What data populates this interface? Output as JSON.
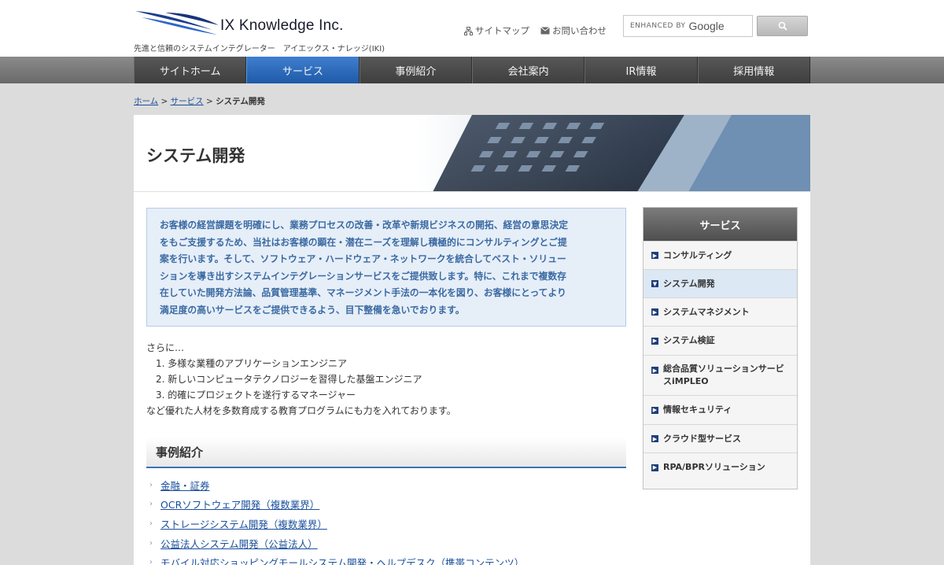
{
  "header": {
    "company_name": "IX Knowledge Inc.",
    "tagline": "先進と信頼のシステムインテグレーター　アイエックス・ナレッジ(IKI)",
    "sitemap_label": "サイトマップ",
    "contact_label": "お問い合わせ",
    "search_enhanced": "ENHANCED BY",
    "search_google": "Google",
    "search_button_icon": "search-icon"
  },
  "nav": {
    "items": [
      "サイトホーム",
      "サービス",
      "事例紹介",
      "会社案内",
      "IR情報",
      "採用情報"
    ],
    "active_index": 1
  },
  "breadcrumb": {
    "home": "ホーム",
    "sep1": " > ",
    "service": "サービス",
    "sep2": " > ",
    "current": "システム開発"
  },
  "page": {
    "title": "システム開発",
    "intro_lines": [
      "お客様の経営課題を明確にし、業務プロセスの改善・改革や新規ビジネスの開拓、経営の意思決定",
      "をもご支援するため、当社はお客様の顕在・潜在ニーズを理解し積極的にコンサルティングとご提",
      "案を行います。そして、ソフトウェア・ハードウェア・ネットワークを統合してベスト・ソリュー",
      "ションを導き出すシステムインテグレーションサービスをご提供致します。特に、これまで複数存",
      "在していた開発方法論、品質管理基準、マネージメント手法の一本化を図り、お客様にとってより",
      "満足度の高いサービスをご提供できるよう、目下整備を急いでおります。"
    ],
    "more_intro": "さらに…",
    "more_items": [
      "1. 多様な業種のアプリケーションエンジニア",
      "2. 新しいコンピュータテクノロジーを習得した基盤エンジニア",
      "3. 的確にプロジェクトを遂行するマネージャー"
    ],
    "more_outro": "など優れた人材を多数育成する教育プログラムにも力を入れております。",
    "cases_heading": "事例紹介",
    "cases": [
      "金融・証券",
      "OCRソフトウェア開発（複数業界）",
      "ストレージシステム開発（複数業界）",
      "公益法人システム開発（公益法人）",
      "モバイル対応ショッピングモールシステム開発・ヘルプデスク（携帯コンテンツ）"
    ]
  },
  "side_menu": {
    "title": "サービス",
    "items": [
      "コンサルティング",
      "システム開発",
      "システムマネジメント",
      "システム検証",
      "総合品質ソリューションサービスiMPLEO",
      "情報セキュリティ",
      "クラウド型サービス",
      "RPA/BPRソリューション"
    ],
    "active_index": 1
  },
  "colors": {
    "accent_blue": "#1e5aa8",
    "link": "#1a4f9c",
    "intro_text": "#3a6aa2"
  }
}
